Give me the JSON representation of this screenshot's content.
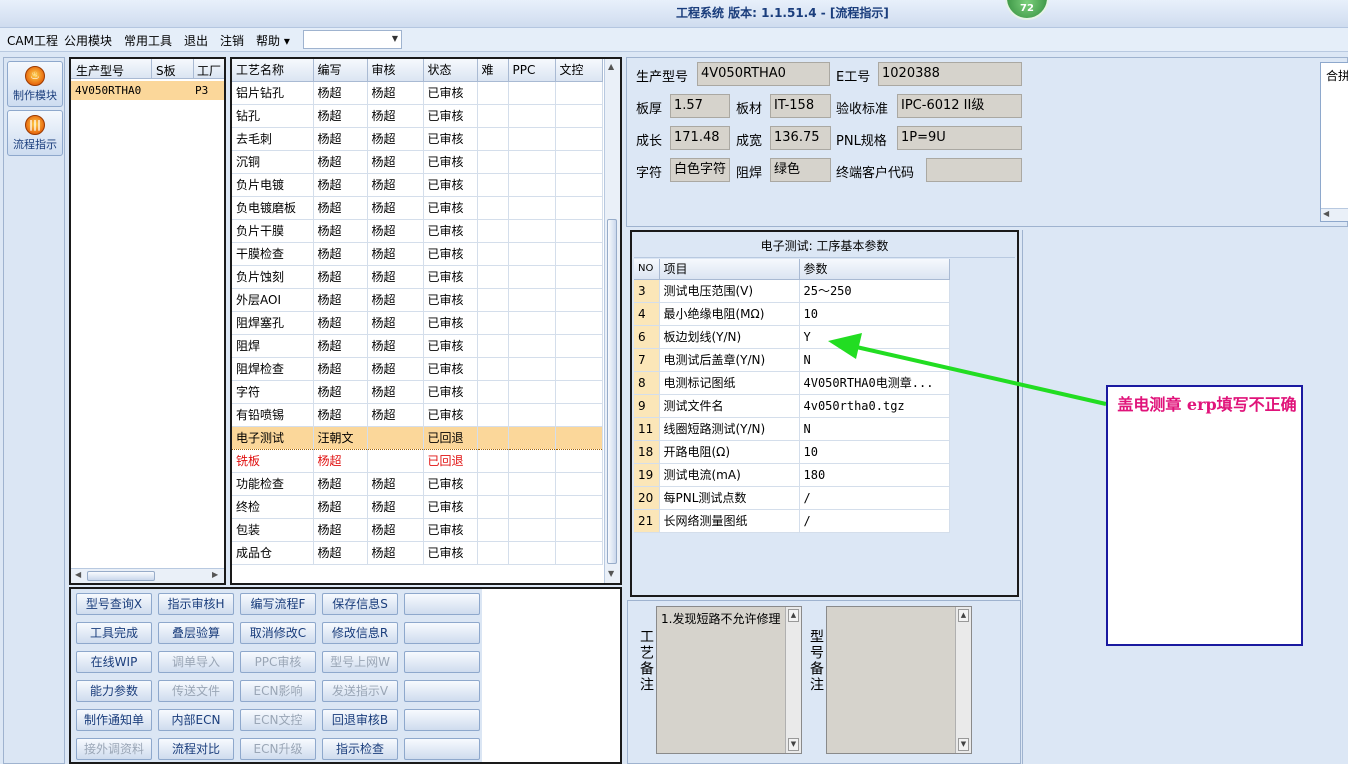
{
  "window": {
    "title": "工程系统  版本: 1.1.51.4 - [流程指示]",
    "badge": "72"
  },
  "menu": {
    "items": [
      "CAM工程",
      "公用模块",
      "常用工具",
      "退出",
      "注销",
      "帮助 ▾"
    ],
    "combo_value": ""
  },
  "nav": [
    {
      "label": "制作模块",
      "icon": "fire-icon"
    },
    {
      "label": "流程指示",
      "icon": "flow-icon"
    }
  ],
  "product_list": {
    "headers": [
      "生产型号",
      "S板",
      "工厂"
    ],
    "rows": [
      {
        "model": "4V050RTHA0",
        "factory": "P3"
      }
    ]
  },
  "process_table": {
    "headers": [
      "工艺名称",
      "编写",
      "审核",
      "状态",
      "难",
      "PPC",
      "文控"
    ],
    "rows": [
      {
        "name": "铝片钻孔",
        "writer": "杨超",
        "reviewer": "杨超",
        "status": "已审核"
      },
      {
        "name": "钻孔",
        "writer": "杨超",
        "reviewer": "杨超",
        "status": "已审核"
      },
      {
        "name": "去毛刺",
        "writer": "杨超",
        "reviewer": "杨超",
        "status": "已审核"
      },
      {
        "name": "沉铜",
        "writer": "杨超",
        "reviewer": "杨超",
        "status": "已审核"
      },
      {
        "name": "负片电镀",
        "writer": "杨超",
        "reviewer": "杨超",
        "status": "已审核"
      },
      {
        "name": "负电镀磨板",
        "writer": "杨超",
        "reviewer": "杨超",
        "status": "已审核"
      },
      {
        "name": "负片干膜",
        "writer": "杨超",
        "reviewer": "杨超",
        "status": "已审核"
      },
      {
        "name": "干膜检查",
        "writer": "杨超",
        "reviewer": "杨超",
        "status": "已审核"
      },
      {
        "name": "负片蚀刻",
        "writer": "杨超",
        "reviewer": "杨超",
        "status": "已审核"
      },
      {
        "name": "外层AOI",
        "writer": "杨超",
        "reviewer": "杨超",
        "status": "已审核"
      },
      {
        "name": "阻焊塞孔",
        "writer": "杨超",
        "reviewer": "杨超",
        "status": "已审核"
      },
      {
        "name": "阻焊",
        "writer": "杨超",
        "reviewer": "杨超",
        "status": "已审核"
      },
      {
        "name": "阻焊检查",
        "writer": "杨超",
        "reviewer": "杨超",
        "status": "已审核"
      },
      {
        "name": "字符",
        "writer": "杨超",
        "reviewer": "杨超",
        "status": "已审核"
      },
      {
        "name": "有铅喷锡",
        "writer": "杨超",
        "reviewer": "杨超",
        "status": "已审核"
      },
      {
        "name": "电子测试",
        "writer": "汪朝文",
        "reviewer": "",
        "status": "已回退",
        "selected": true
      },
      {
        "name": "铣板",
        "writer": "杨超",
        "reviewer": "",
        "status": "已回退",
        "red": true
      },
      {
        "name": "功能检查",
        "writer": "杨超",
        "reviewer": "杨超",
        "status": "已审核"
      },
      {
        "name": "终检",
        "writer": "杨超",
        "reviewer": "杨超",
        "status": "已审核"
      },
      {
        "name": "包装",
        "writer": "杨超",
        "reviewer": "杨超",
        "status": "已审核"
      },
      {
        "name": "成品仓",
        "writer": "杨超",
        "reviewer": "杨超",
        "status": "已审核"
      }
    ]
  },
  "buttons": [
    [
      {
        "label": "型号查询X"
      },
      {
        "label": "指示审核H"
      },
      {
        "label": "编写流程F"
      },
      {
        "label": "保存信息S"
      },
      {
        "label": ""
      }
    ],
    [
      {
        "label": "工具完成"
      },
      {
        "label": "叠层验算"
      },
      {
        "label": "取消修改C"
      },
      {
        "label": "修改信息R"
      },
      {
        "label": ""
      }
    ],
    [
      {
        "label": "在线WIP"
      },
      {
        "label": "调单导入",
        "disabled": true
      },
      {
        "label": "PPC审核",
        "disabled": true
      },
      {
        "label": "型号上网W",
        "disabled": true
      },
      {
        "label": ""
      }
    ],
    [
      {
        "label": "能力参数"
      },
      {
        "label": "传送文件",
        "disabled": true
      },
      {
        "label": "ECN影响",
        "disabled": true
      },
      {
        "label": "发送指示V",
        "disabled": true
      },
      {
        "label": ""
      }
    ],
    [
      {
        "label": "制作通知单"
      },
      {
        "label": "内部ECN"
      },
      {
        "label": "ECN文控",
        "disabled": true
      },
      {
        "label": "回退审核B"
      },
      {
        "label": ""
      }
    ],
    [
      {
        "label": "接外调资料",
        "disabled": true
      },
      {
        "label": "流程对比"
      },
      {
        "label": "ECN升级",
        "disabled": true
      },
      {
        "label": "指示检查"
      },
      {
        "label": ""
      }
    ]
  ],
  "info": {
    "model_label": "生产型号",
    "model_value": "4V050RTHA0",
    "e_label": "E工号",
    "e_value": "1020388",
    "thick_label": "板厚",
    "thick_value": "1.57",
    "material_label": "板材",
    "material_value": "IT-158",
    "std_label": "验收标准",
    "std_value": "IPC-6012 II级",
    "len_label": "成长",
    "len_value": "171.48",
    "wid_label": "成宽",
    "wid_value": "136.75",
    "pnl_label": "PNL规格",
    "pnl_value": "1P=9U",
    "char_label": "字符",
    "char_value": "白色字符",
    "mask_label": "阻焊",
    "mask_value": "绿色",
    "cust_label": "终端客户代码",
    "cust_value": "",
    "merge_label": "合拼"
  },
  "params": {
    "title": "电子测试: 工序基本参数",
    "headers": [
      "NO",
      "项目",
      "参数"
    ],
    "rows": [
      {
        "no": "3",
        "item": "测试电压范围(V)",
        "value": "25～250"
      },
      {
        "no": "4",
        "item": "最小绝缘电阻(MΩ)",
        "value": "10"
      },
      {
        "no": "6",
        "item": "板边划线(Y/N)",
        "value": "Y"
      },
      {
        "no": "7",
        "item": "电测试后盖章(Y/N)",
        "value": "N"
      },
      {
        "no": "8",
        "item": "电测标记图纸",
        "value": "4V050RTHA0电测章..."
      },
      {
        "no": "9",
        "item": "测试文件名",
        "value": "4v050rtha0.tgz"
      },
      {
        "no": "11",
        "item": "线圈短路测试(Y/N)",
        "value": "N"
      },
      {
        "no": "18",
        "item": "开路电阻(Ω)",
        "value": "10"
      },
      {
        "no": "19",
        "item": "测试电流(mA)",
        "value": "180"
      },
      {
        "no": "20",
        "item": "每PNL测试点数",
        "value": "/"
      },
      {
        "no": "21",
        "item": "长网络测量图纸",
        "value": "/"
      }
    ]
  },
  "remarks": {
    "process_label": "工艺备注",
    "process_text": "1.发现短路不允许修理",
    "model_label": "型号备注",
    "model_text": ""
  },
  "annotation": {
    "text": "盖电测章  erp填写不正确",
    "color": "#e0137a",
    "arrow_color": "#22dd22"
  }
}
